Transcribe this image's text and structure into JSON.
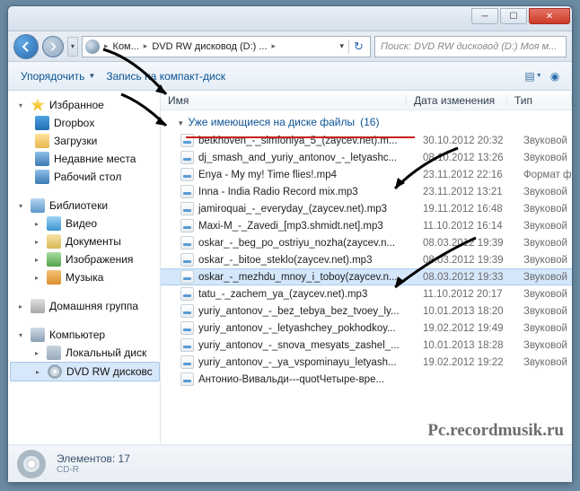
{
  "address": {
    "seg1": "Ком...",
    "seg2": "DVD RW дисковод (D:) ..."
  },
  "search": {
    "placeholder": "Поиск: DVD RW дисковод (D:) Моя м..."
  },
  "toolbar": {
    "organize": "Упорядочить",
    "burn": "Запись на компакт-диск"
  },
  "columns": {
    "name": "Имя",
    "date": "Дата изменения",
    "type": "Тип"
  },
  "group_header": {
    "label": "Уже имеющиеся на диске файлы",
    "count": "(16)"
  },
  "nav": {
    "favorites": "Избранное",
    "dropbox": "Dropbox",
    "downloads": "Загрузки",
    "recent": "Недавние места",
    "desktop": "Рабочий стол",
    "libraries": "Библиотеки",
    "video": "Видео",
    "documents": "Документы",
    "images": "Изображения",
    "music": "Музыка",
    "homegroup": "Домашняя группа",
    "computer": "Компьютер",
    "localdisk": "Локальный диск",
    "dvd": "DVD RW дисковс"
  },
  "files": [
    {
      "name": "betkhoven_-_simfoniya_5_(zaycev.net).m...",
      "date": "30.10.2012 20:32",
      "type": "Звуковой"
    },
    {
      "name": "dj_smash_and_yuriy_antonov_-_letyashc...",
      "date": "08.10.2012 13:26",
      "type": "Звуковой"
    },
    {
      "name": "Enya - My my! Time flies!.mp4",
      "date": "23.11.2012 22:16",
      "type": "Формат ф"
    },
    {
      "name": "Inna - India Radio Record mix.mp3",
      "date": "23.11.2012 13:21",
      "type": "Звуковой"
    },
    {
      "name": "jamiroquai_-_everyday_(zaycev.net).mp3",
      "date": "19.11.2012 16:48",
      "type": "Звуковой"
    },
    {
      "name": "Maxi-M_-_Zavedi_[mp3.shmidt.net].mp3",
      "date": "11.10.2012 16:14",
      "type": "Звуковой"
    },
    {
      "name": "oskar_-_beg_po_ostriyu_nozha(zaycev.n...",
      "date": "08.03.2012 19:39",
      "type": "Звуковой"
    },
    {
      "name": "oskar_-_bitoe_steklo(zaycev.net).mp3",
      "date": "08.03.2012 19:39",
      "type": "Звуковой"
    },
    {
      "name": "oskar_-_mezhdu_mnoy_i_toboy(zaycev.n...",
      "date": "08.03.2012 19:33",
      "type": "Звуковой"
    },
    {
      "name": "tatu_-_zachem_ya_(zaycev.net).mp3",
      "date": "11.10.2012 20:17",
      "type": "Звуковой"
    },
    {
      "name": "yuriy_antonov_-_bez_tebya_bez_tvoey_ly...",
      "date": "10.01.2013 18:20",
      "type": "Звуковой"
    },
    {
      "name": "yuriy_antonov_-_letyashchey_pokhodkoy...",
      "date": "19.02.2012 19:49",
      "type": "Звуковой"
    },
    {
      "name": "yuriy_antonov_-_snova_mesyats_zashel_...",
      "date": "10.01.2013 18:28",
      "type": "Звуковой"
    },
    {
      "name": "yuriy_antonov_-_ya_vspominayu_letyash...",
      "date": "19.02.2012 19:22",
      "type": "Звуковой"
    },
    {
      "name": "Антонио-Вивальди---quotЧетыре-вре...",
      "date": "",
      "type": ""
    }
  ],
  "status": {
    "label": "Элементов:",
    "count": "17",
    "media": "CD-R"
  },
  "watermark": "Pc.recordmusik.ru"
}
